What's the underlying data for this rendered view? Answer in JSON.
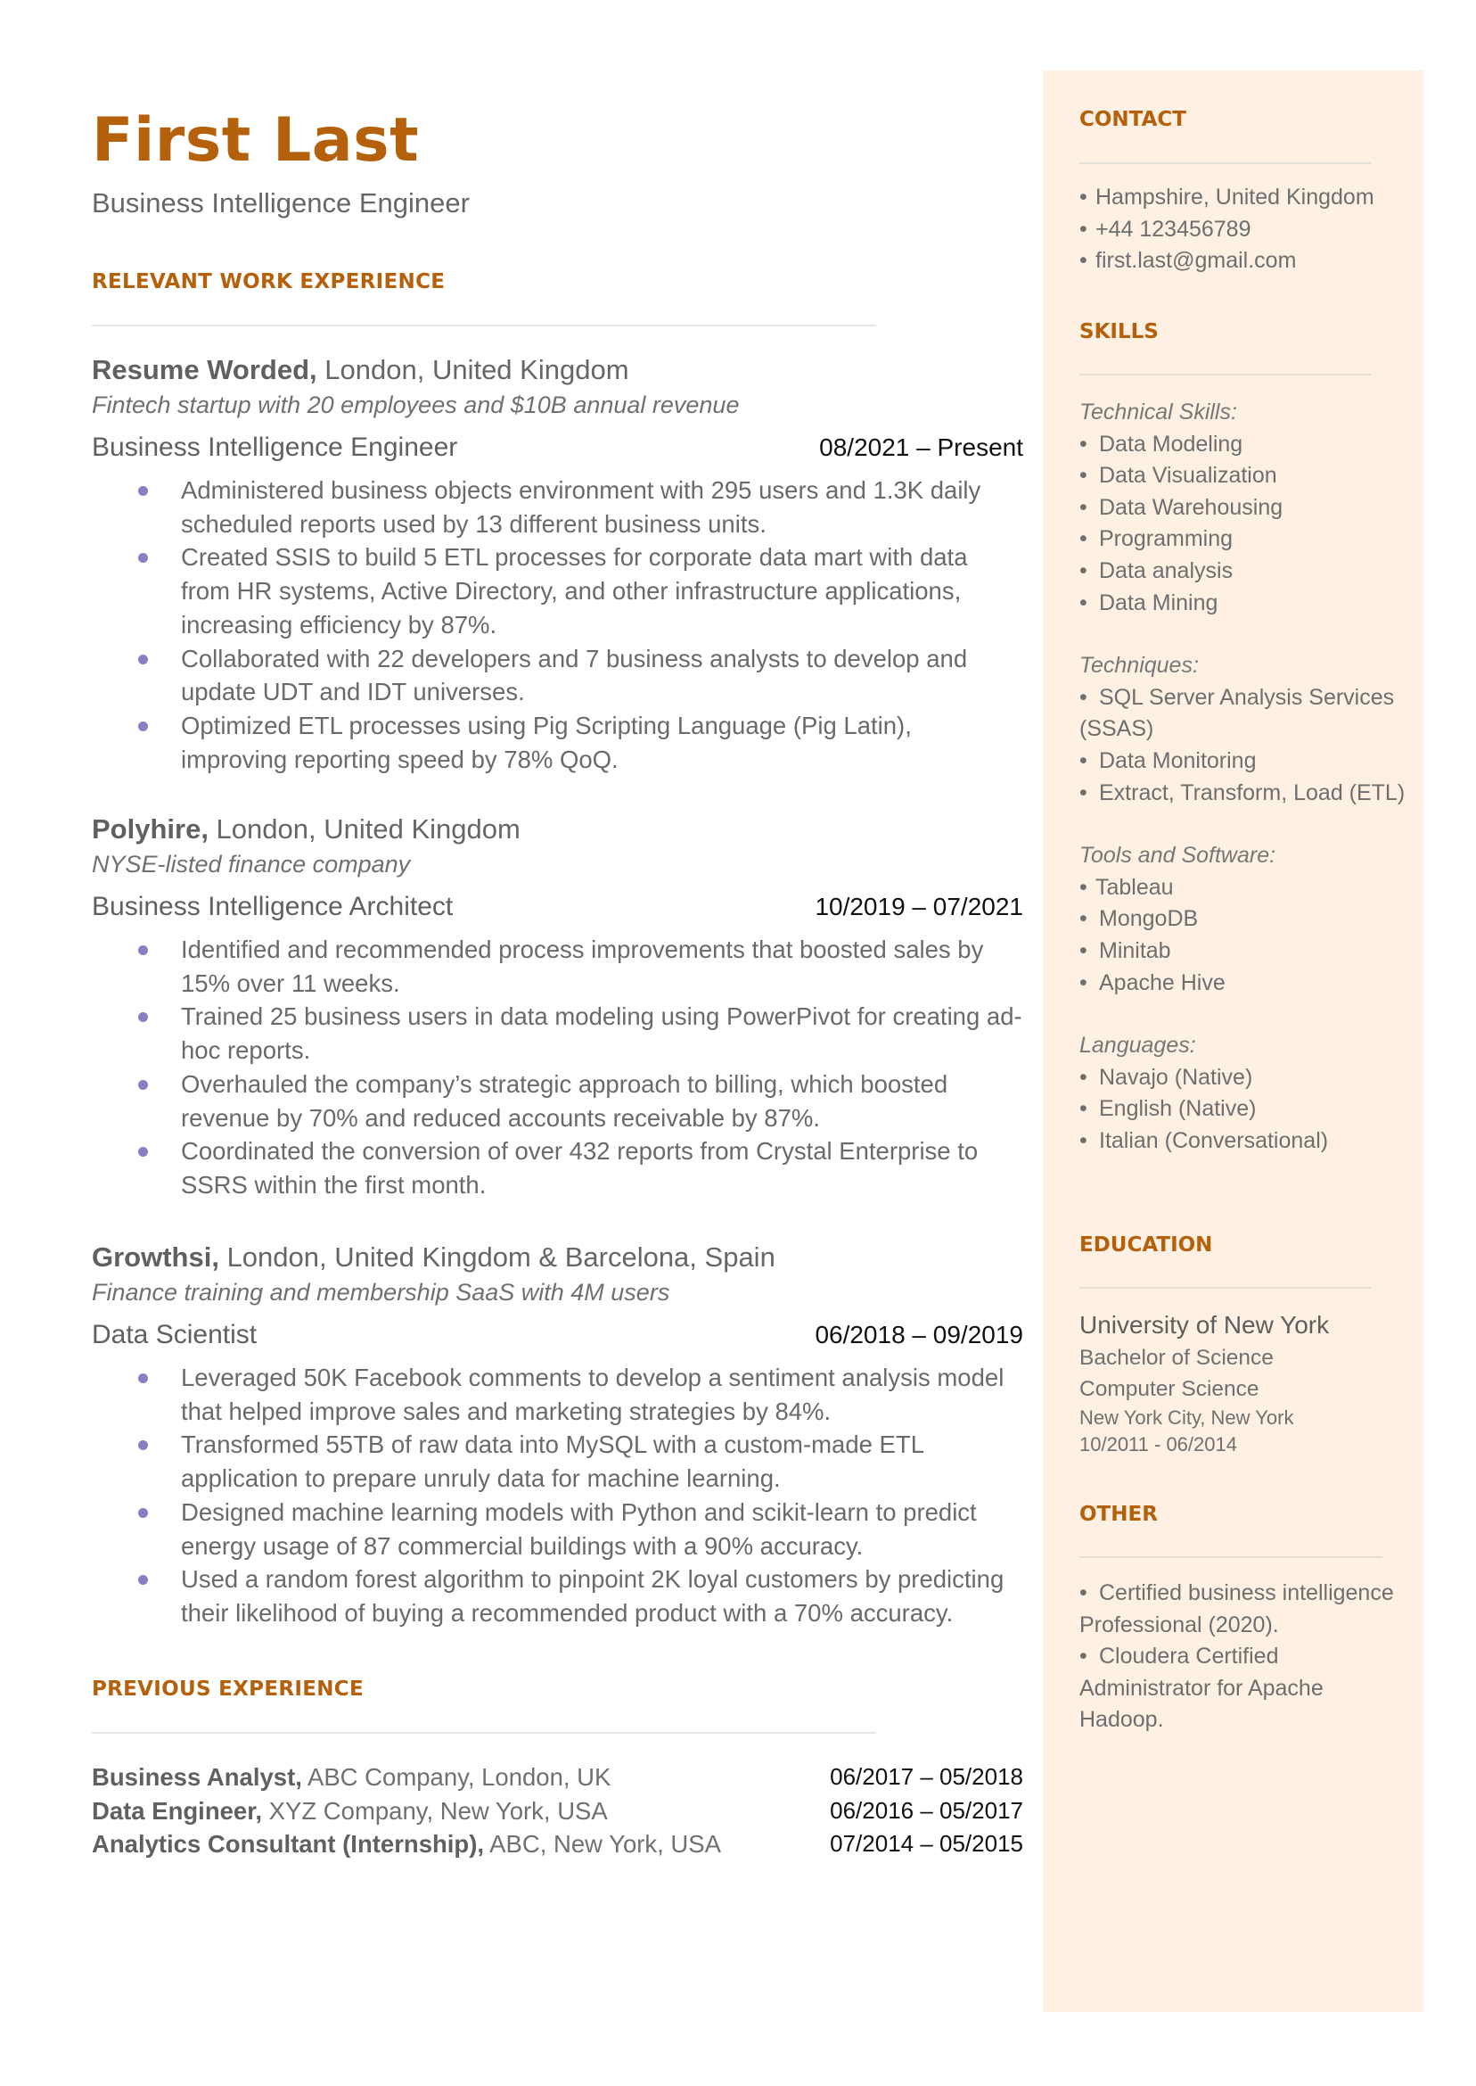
{
  "header": {
    "name": "First Last",
    "title": "Business Intelligence Engineer"
  },
  "colors": {
    "accent": "#B5600A",
    "sidebar_bg": "#FEF0E2",
    "bullet": "#8E7CC3"
  },
  "sections": {
    "relevant_experience": "RELEVANT WORK EXPERIENCE",
    "previous_experience": "PREVIOUS EXPERIENCE",
    "contact": "CONTACT",
    "skills": "SKILLS",
    "education": "EDUCATION",
    "other": "OTHER"
  },
  "jobs": [
    {
      "company": "Resume Worded,",
      "location": " London, United Kingdom",
      "description": "Fintech startup with 20 employees and $10B annual revenue",
      "role": "Business Intelligence Engineer",
      "dates": "08/2021 – Present",
      "bullets": [
        "Administered business objects environment with 295 users and 1.3K daily scheduled reports used by 13 different business units.",
        "Created SSIS to build 5 ETL processes for corporate data mart with data from HR systems, Active Directory, and other infrastructure applications, increasing efficiency by 87%.",
        "Collaborated with 22 developers and 7 business analysts to develop and update UDT and IDT universes.",
        "Optimized ETL processes using Pig Scripting Language (Pig Latin), improving reporting speed by 78% QoQ."
      ]
    },
    {
      "company": "Polyhire,",
      "location": " London, United Kingdom",
      "description": "NYSE-listed finance company",
      "role": "Business Intelligence Architect",
      "dates": "10/2019 – 07/2021",
      "bullets": [
        "Identified and recommended process improvements that boosted sales by 15% over 11 weeks.",
        "Trained 25 business users in data modeling using PowerPivot for creating ad-hoc reports.",
        "Overhauled the company’s strategic approach to billing, which boosted revenue by 70% and reduced accounts receivable by 87%.",
        "Coordinated the conversion of over 432 reports from Crystal Enterprise to SSRS within the first month."
      ]
    },
    {
      "company": "Growthsi,",
      "location": " London, United Kingdom & Barcelona, Spain",
      "description": "Finance training and membership SaaS with 4M users",
      "role": "Data Scientist",
      "dates": "06/2018 – 09/2019",
      "bullets": [
        "Leveraged 50K Facebook comments to develop a sentiment analysis model that helped improve sales and marketing strategies by 84%.",
        "Transformed 55TB of raw data into MySQL with a custom-made ETL application to prepare unruly data for machine learning.",
        "Designed machine learning models with Python and scikit-learn to predict energy usage of 87 commercial buildings with a 90% accuracy.",
        "Used a random forest algorithm to pinpoint 2K loyal customers by predicting their likelihood of buying a recommended product with a 70% accuracy."
      ]
    }
  ],
  "previous": [
    {
      "title": "Business Analyst,",
      "rest": " ABC Company, London, UK",
      "dates": "06/2017 – 05/2018"
    },
    {
      "title": "Data Engineer,",
      "rest": " XYZ Company, New York, USA",
      "dates": "06/2016 – 05/2017"
    },
    {
      "title": "Analytics Consultant (Internship),",
      "rest": " ABC, New York, USA",
      "dates": "07/2014 – 05/2015"
    }
  ],
  "contact": {
    "bullet": "•",
    "items": [
      "Hampshire, United Kingdom",
      "+44 123456789",
      "first.last@gmail.com"
    ]
  },
  "skills": {
    "groups": [
      {
        "label": "Technical Skills:",
        "items": [
          "Data Modeling",
          "Data Visualization",
          "Data Warehousing",
          "Programming",
          "Data analysis",
          "Data Mining"
        ]
      },
      {
        "label": "Techniques:",
        "items": [
          "SQL Server Analysis Services (SSAS)",
          "Data Monitoring",
          "Extract, Transform, Load (ETL)"
        ]
      },
      {
        "label": "Tools and Software:",
        "items": [
          "Tableau",
          "MongoDB",
          "Minitab",
          "Apache Hive"
        ]
      },
      {
        "label": "Languages:",
        "items": [
          "Navajo (Native)",
          "English (Native)",
          "Italian (Conversational)"
        ]
      }
    ]
  },
  "education": {
    "school": "University of New York",
    "degree": "Bachelor of Science",
    "field": "Computer Science",
    "location": "New York City, New York",
    "dates": "10/2011 - 06/2014"
  },
  "other": {
    "items": [
      "Certified business intelligence Professional (2020).",
      "Cloudera Certified Administrator for Apache Hadoop."
    ]
  }
}
